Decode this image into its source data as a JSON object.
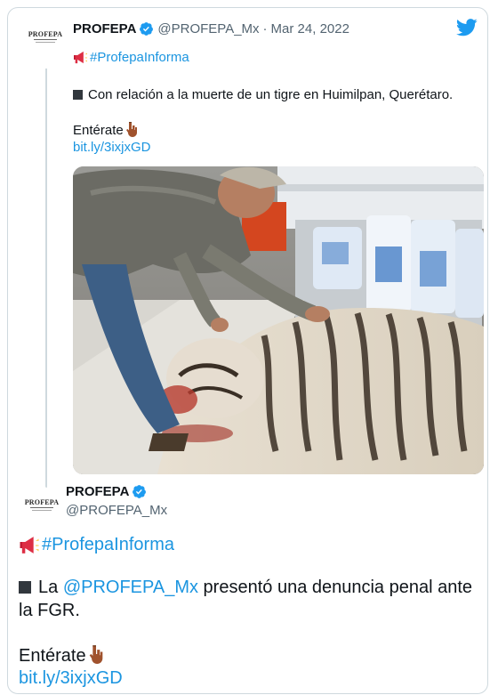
{
  "quoted_tweet": {
    "avatar_label": "PROFEPA",
    "display_name": "PROFEPA",
    "handle": "@PROFEPA_Mx",
    "separator": "·",
    "date": "Mar 24, 2022",
    "hashtag": "#ProfepaInforma",
    "line1": "Con relación a la muerte de un tigre en Huimilpan, Querétaro.",
    "enterate": "Entérate",
    "link": "bit.ly/3ixjxGD"
  },
  "main_tweet": {
    "avatar_label": "PROFEPA",
    "display_name": "PROFEPA",
    "handle": "@PROFEPA_Mx",
    "hashtag": "#ProfepaInforma",
    "body_prefix": "La ",
    "mention": "@PROFEPA_Mx",
    "body_suffix": " presentó una denuncia penal ante la FGR.",
    "enterate": "Entérate",
    "link": "bit.ly/3ixjxGD"
  },
  "icons": {
    "verified": "verified-badge-icon",
    "megaphone": "megaphone-icon",
    "pointing_hand": "pointing-down-hand-icon",
    "black_square": "black-square-icon",
    "twitter": "twitter-bird-icon"
  },
  "colors": {
    "link": "#1b95e0",
    "text": "#0f1419",
    "muted": "#536471",
    "border": "#cfd9de",
    "verified": "#1d9bf0",
    "twitter": "#1d9bf0"
  }
}
